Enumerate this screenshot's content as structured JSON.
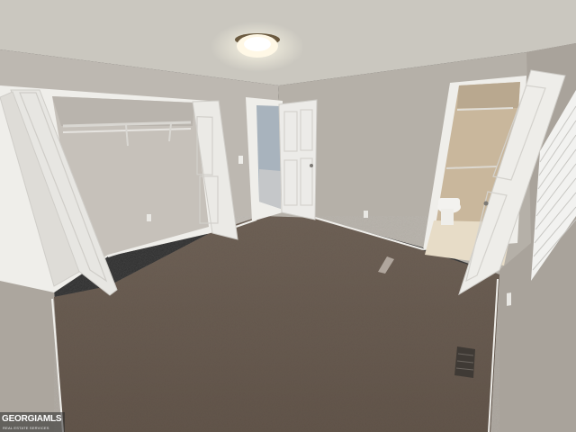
{
  "photo": {
    "subject": "empty-bedroom-interior",
    "colors": {
      "ceiling": "#cfcbc4",
      "wall": "#bdb8b1",
      "wall_shade": "#a9a39b",
      "carpet": "#6a5d52",
      "carpet_dark": "#56493f",
      "door": "#ecebe8",
      "trim": "#f1f0ec",
      "light": "#fff8e6"
    }
  },
  "watermark": {
    "brand": "GEORGIAMLS",
    "tagline": "REAL ESTATE SERVICES"
  }
}
